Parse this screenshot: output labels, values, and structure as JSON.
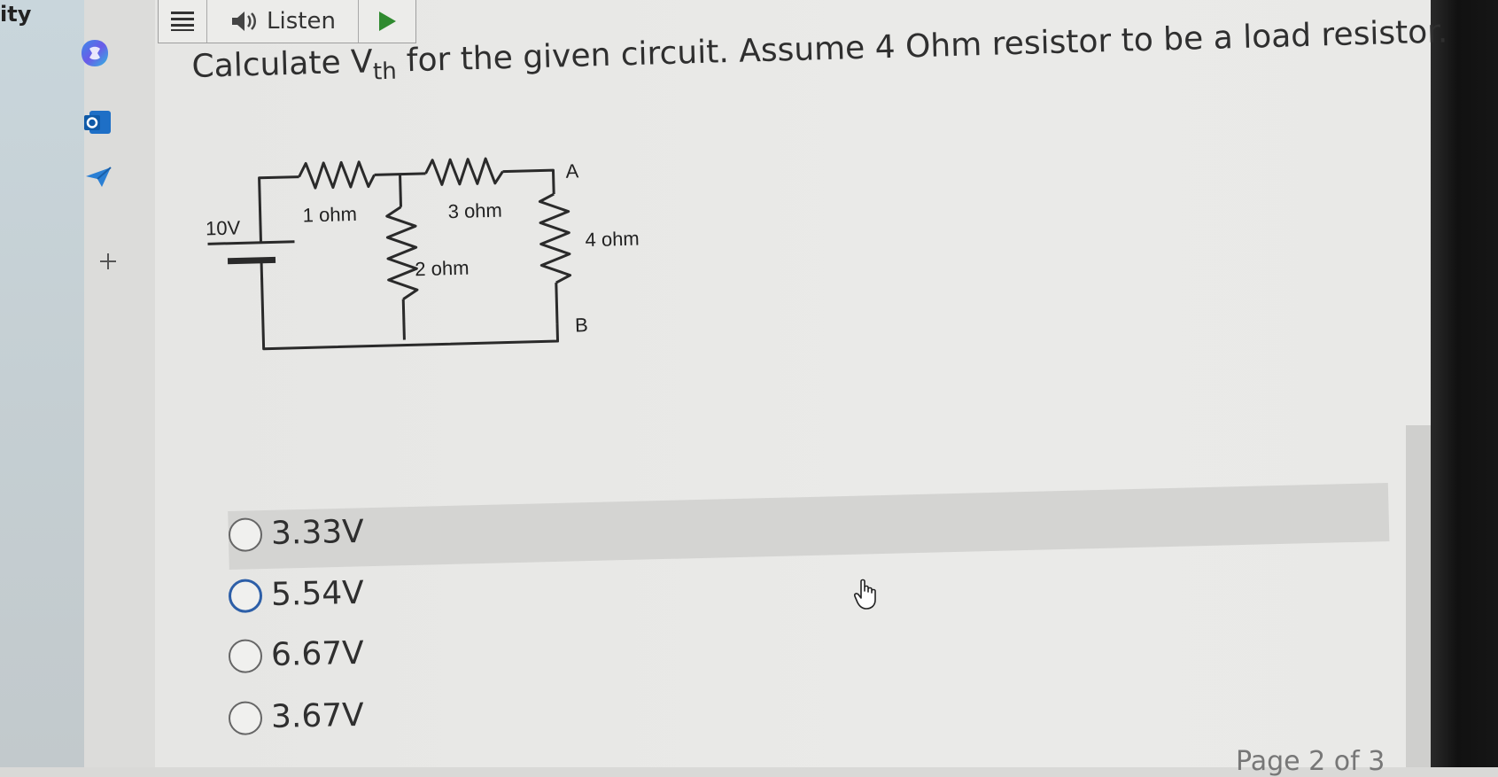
{
  "crop_text": "ity",
  "toolbar": {
    "listen_label": "Listen"
  },
  "question": {
    "prefix": "Calculate V",
    "subscript": "th",
    "suffix": " for the given circuit. Assume 4 Ohm resistor to be a load resistor."
  },
  "circuit": {
    "source_label": "10V",
    "r1_label": "1 ohm",
    "r2_label": "2 ohm",
    "r3_label": "3 ohm",
    "r4_label": "4 ohm",
    "node_a": "A",
    "node_b": "B"
  },
  "options": [
    {
      "label": "3.33V"
    },
    {
      "label": "5.54V"
    },
    {
      "label": "6.67V"
    },
    {
      "label": "3.67V"
    }
  ],
  "footer": {
    "page_text": "Page 2 of 3"
  },
  "colors": {
    "accent": "#2d5fa8",
    "outlook_blue": "#1e6fc6"
  }
}
